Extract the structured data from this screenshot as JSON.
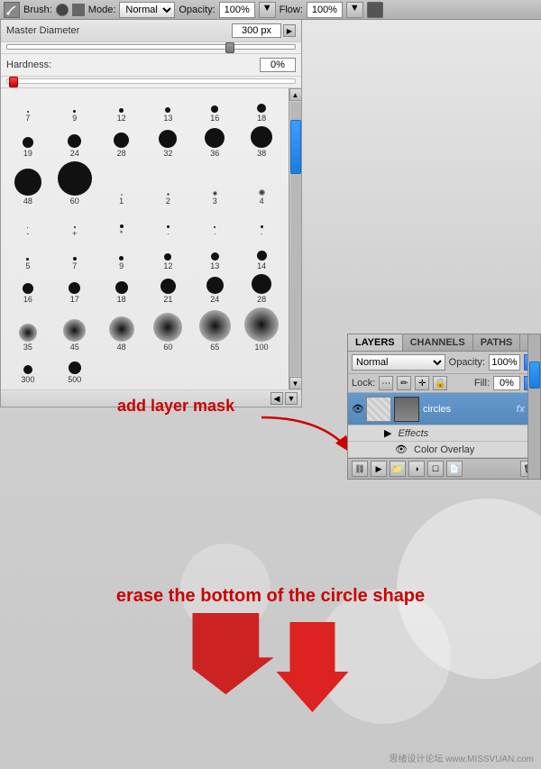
{
  "toolbar": {
    "brush_label": "Brush:",
    "mode_label": "Mode:",
    "mode_value": "Normal",
    "opacity_label": "Opacity:",
    "opacity_value": "100%",
    "flow_label": "Flow:",
    "flow_value": "100%"
  },
  "brush_panel": {
    "diameter_label": "Master Diameter",
    "diameter_value": "300 px",
    "hardness_label": "Hardness:",
    "hardness_value": "0%",
    "brushes": [
      {
        "size": 2,
        "label": "7"
      },
      {
        "size": 3,
        "label": "9"
      },
      {
        "size": 5,
        "label": "12"
      },
      {
        "size": 6,
        "label": "13"
      },
      {
        "size": 8,
        "label": "16"
      },
      {
        "size": 10,
        "label": "18"
      },
      {
        "size": 12,
        "label": "19"
      },
      {
        "size": 15,
        "label": "24"
      },
      {
        "size": 17,
        "label": "28"
      },
      {
        "size": 20,
        "label": "32"
      },
      {
        "size": 22,
        "label": "36"
      },
      {
        "size": 24,
        "label": "38"
      },
      {
        "size": 30,
        "label": "48"
      },
      {
        "size": 38,
        "label": "60"
      },
      {
        "size": 2,
        "label": "1",
        "soft": true
      },
      {
        "size": 3,
        "label": "2",
        "soft": true
      },
      {
        "size": 5,
        "label": "3",
        "soft": true
      },
      {
        "size": 7,
        "label": "4",
        "soft": true
      },
      {
        "size": 1,
        "label": "-"
      },
      {
        "size": 2,
        "label": "+"
      },
      {
        "size": 4,
        "label": "*"
      },
      {
        "size": 3,
        "label": "·"
      },
      {
        "size": 2,
        "label": "·"
      },
      {
        "size": 3,
        "label": "·"
      },
      {
        "size": 3,
        "label": "5"
      },
      {
        "size": 4,
        "label": "7"
      },
      {
        "size": 5,
        "label": "9"
      },
      {
        "size": 8,
        "label": "12"
      },
      {
        "size": 9,
        "label": "13"
      },
      {
        "size": 11,
        "label": "14"
      },
      {
        "size": 12,
        "label": "16"
      },
      {
        "size": 13,
        "label": "17"
      },
      {
        "size": 14,
        "label": "18"
      },
      {
        "size": 17,
        "label": "21"
      },
      {
        "size": 19,
        "label": "24"
      },
      {
        "size": 22,
        "label": "28"
      },
      {
        "size": 20,
        "label": "35",
        "soft": true
      },
      {
        "size": 25,
        "label": "45",
        "soft": true
      },
      {
        "size": 28,
        "label": "48",
        "soft": true
      },
      {
        "size": 32,
        "label": "60",
        "soft": true
      },
      {
        "size": 35,
        "label": "65",
        "soft": true
      },
      {
        "size": 38,
        "label": "100",
        "soft": true
      },
      {
        "size": 10,
        "label": "300"
      },
      {
        "size": 14,
        "label": "500"
      }
    ]
  },
  "annotations": {
    "mask_text": "add layer mask",
    "erase_text": "erase the bottom of the circle shape"
  },
  "layers_panel": {
    "tabs": [
      "LAYERS",
      "CHANNELS",
      "PATHS"
    ],
    "active_tab": "LAYERS",
    "blend_mode": "Normal",
    "opacity_label": "Opacity:",
    "opacity_value": "100%",
    "lock_label": "Lock:",
    "fill_label": "Fill:",
    "fill_value": "0%",
    "layer_name": "circles",
    "effects_label": "Effects",
    "color_overlay_label": "Color Overlay"
  },
  "watermark": "思绪设计论坛 www.MISSVUAN.com"
}
